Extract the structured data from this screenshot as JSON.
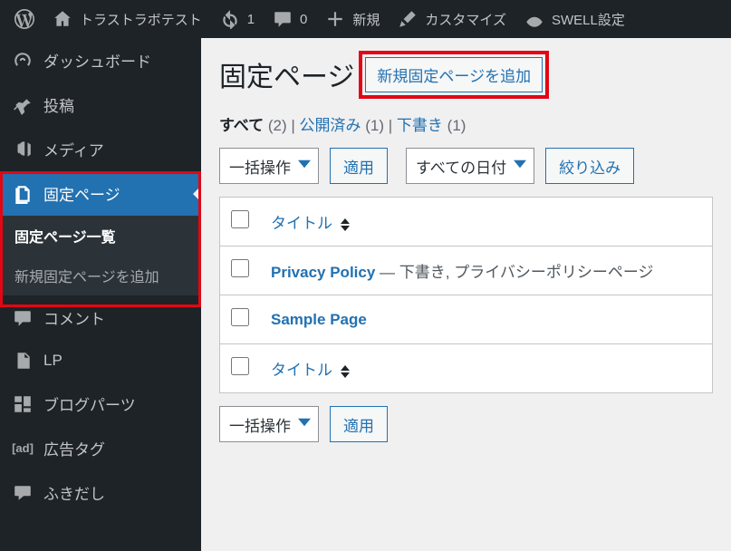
{
  "adminbar": {
    "site_name": "トラストラボテスト",
    "updates_count": "1",
    "comments_count": "0",
    "new_label": "新規",
    "customize_label": "カスタマイズ",
    "swell_label": "SWELL設定"
  },
  "sidebar": {
    "items": [
      {
        "label": "ダッシュボード",
        "icon": "dashboard"
      },
      {
        "label": "投稿",
        "icon": "pin"
      },
      {
        "label": "メディア",
        "icon": "media"
      },
      {
        "label": "固定ページ",
        "icon": "page",
        "current": true
      },
      {
        "label": "コメント",
        "icon": "comment"
      },
      {
        "label": "LP",
        "icon": "file"
      },
      {
        "label": "ブログパーツ",
        "icon": "grid"
      },
      {
        "label": "広告タグ",
        "icon": "adtag"
      },
      {
        "label": "ふきだし",
        "icon": "speech"
      }
    ],
    "submenu": {
      "list_label": "固定ページ一覧",
      "add_label": "新規固定ページを追加"
    }
  },
  "page": {
    "heading": "固定ページ",
    "add_new_label": "新規固定ページを追加",
    "filters": {
      "all_label": "すべて",
      "all_count": "(2)",
      "published_label": "公開済み",
      "published_count": "(1)",
      "draft_label": "下書き",
      "draft_count": "(1)",
      "sep": " | "
    },
    "bulk_action_label": "一括操作",
    "apply_label": "適用",
    "date_filter_label": "すべての日付",
    "filter_button_label": "絞り込み",
    "columns": {
      "title": "タイトル"
    },
    "rows": [
      {
        "title": "Privacy Policy",
        "meta": " — 下書き, プライバシーポリシーページ"
      },
      {
        "title": "Sample Page",
        "meta": ""
      }
    ]
  }
}
